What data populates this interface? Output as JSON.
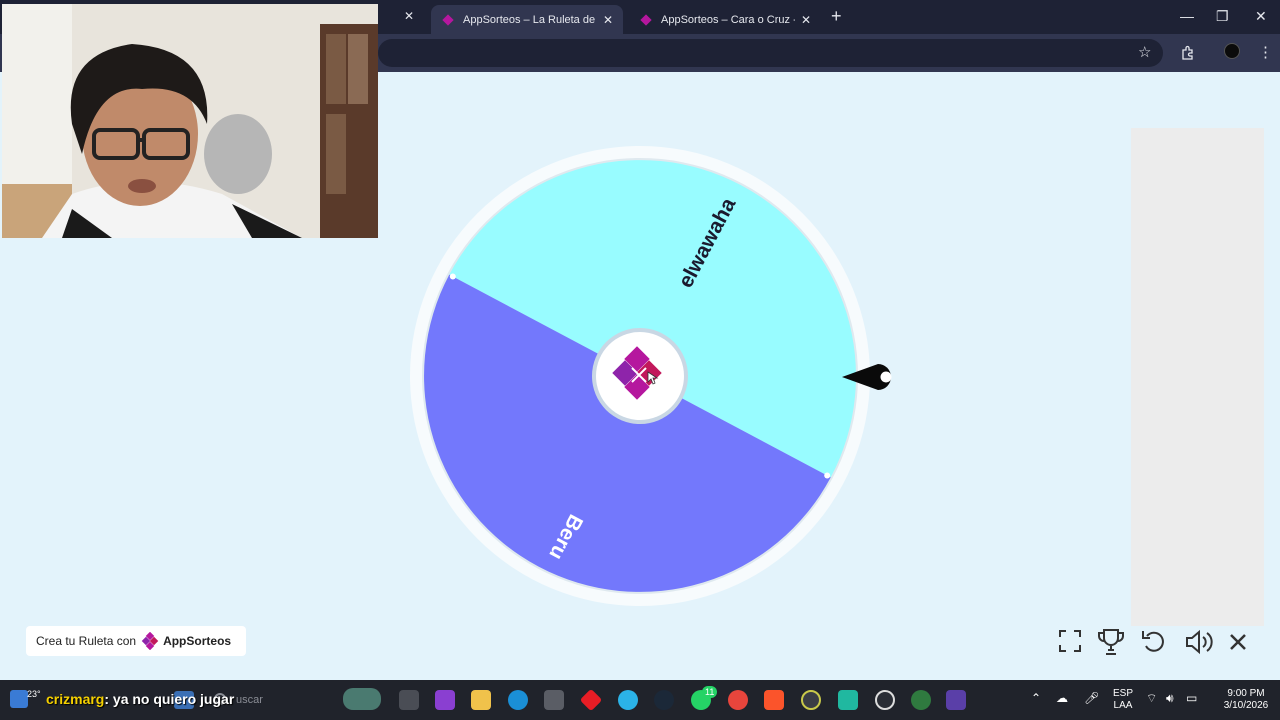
{
  "browser": {
    "tabs": [
      {
        "title": "AppSorteos – La Ruleta de la Suerte",
        "active": true
      },
      {
        "title": "AppSorteos – Cara o Cruz - Tirar Moneda",
        "active": false
      }
    ]
  },
  "wheel": {
    "segments": [
      {
        "label": "elwawaha",
        "color": "#98fcff"
      },
      {
        "label": "Beru",
        "color": "#7378fc"
      }
    ],
    "center_icon": "appsorteos-logo-icon"
  },
  "footer": {
    "prefix": "Crea tu Ruleta con",
    "brand": "AppSorteos"
  },
  "controls": [
    "fullscreen-icon",
    "trophy-icon",
    "reset-icon",
    "volume-icon",
    "close-icon"
  ],
  "stream_overlay": {
    "temperature": "23°",
    "chat_user": "crizmarg",
    "chat_message": ": ya no quiero jugar"
  },
  "taskbar": {
    "search_placeholder": "uscar",
    "notification_count": "11",
    "language": "ESP",
    "layout": "LAA",
    "time": "9:00 PM",
    "date": "3/10/2026"
  },
  "colors": {
    "page_bg": "#e3f3fb",
    "brand_magenta": "#b5179e",
    "brand_purple": "#7b1fa2"
  }
}
